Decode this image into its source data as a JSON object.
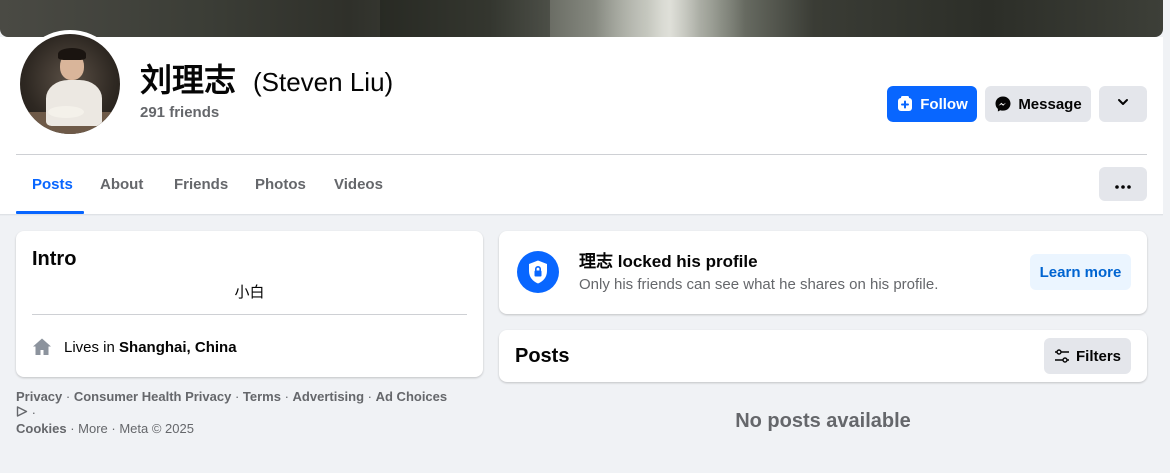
{
  "profile": {
    "name": "刘理志",
    "alternate_name": "(Steven Liu)",
    "friends_count": "291 friends"
  },
  "actions": {
    "follow_label": "Follow",
    "message_label": "Message"
  },
  "tabs": [
    {
      "label": "Posts",
      "active": true
    },
    {
      "label": "About"
    },
    {
      "label": "Friends"
    },
    {
      "label": "Photos"
    },
    {
      "label": "Videos"
    }
  ],
  "intro": {
    "title": "Intro",
    "bio": "小白",
    "lives_prefix": "Lives in ",
    "lives_city": "Shanghai, China"
  },
  "footer": {
    "links": [
      "Privacy",
      "Consumer Health Privacy",
      "Terms",
      "Advertising",
      "Ad Choices",
      "Cookies",
      "More"
    ],
    "copyright": "Meta © 2025"
  },
  "locked": {
    "title_name": "理志",
    "title_rest": " locked his profile",
    "subtitle": "Only his friends can see what he shares on his profile.",
    "learn_more_label": "Learn more"
  },
  "posts": {
    "title": "Posts",
    "filters_label": "Filters",
    "empty_text": "No posts available"
  },
  "colors": {
    "accent": "#0866ff",
    "background": "#f0f2f5",
    "secondary_text": "#65676b"
  }
}
